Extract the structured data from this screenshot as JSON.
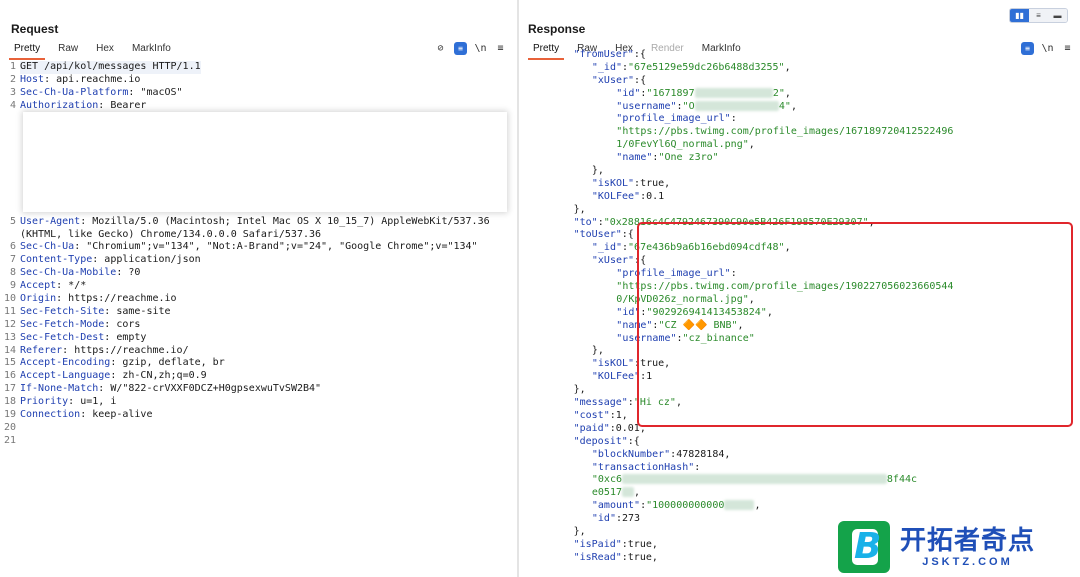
{
  "request": {
    "title": "Request",
    "tabs": [
      "Pretty",
      "Raw",
      "Hex",
      "MarkInfo"
    ],
    "active_tab": "Pretty",
    "tools": {
      "hide": "⊘",
      "newline": "\\n",
      "menu": "≡"
    },
    "lines": [
      {
        "n": "1",
        "k": "",
        "v": "GET /api/kol/messages HTTP/1.1"
      },
      {
        "n": "2",
        "k": "Host",
        "v": "api.reachme.io"
      },
      {
        "n": "3",
        "k": "Sec-Ch-Ua-Platform",
        "v": "\"macOS\""
      },
      {
        "n": "4",
        "k": "Authorization",
        "v": "Bearer"
      },
      {
        "n": "",
        "k": "",
        "v": ""
      },
      {
        "n": "",
        "k": "",
        "v": ""
      },
      {
        "n": "",
        "k": "",
        "v": ""
      },
      {
        "n": "",
        "k": "",
        "v": ""
      },
      {
        "n": "",
        "k": "",
        "v": ""
      },
      {
        "n": "",
        "k": "",
        "v": ""
      },
      {
        "n": "",
        "k": "",
        "v": ""
      },
      {
        "n": "",
        "k": "",
        "v": ""
      },
      {
        "n": "5",
        "k": "User-Agent",
        "v": "Mozilla/5.0 (Macintosh; Intel Mac OS X 10_15_7) AppleWebKit/537.36"
      },
      {
        "n": "",
        "k": "",
        "v": "(KHTML, like Gecko) Chrome/134.0.0.0 Safari/537.36"
      },
      {
        "n": "6",
        "k": "Sec-Ch-Ua",
        "v": "\"Chromium\";v=\"134\", \"Not:A-Brand\";v=\"24\", \"Google Chrome\";v=\"134\""
      },
      {
        "n": "7",
        "k": "Content-Type",
        "v": "application/json"
      },
      {
        "n": "8",
        "k": "Sec-Ch-Ua-Mobile",
        "v": "?0"
      },
      {
        "n": "9",
        "k": "Accept",
        "v": "*/*"
      },
      {
        "n": "10",
        "k": "Origin",
        "v": "https://reachme.io"
      },
      {
        "n": "11",
        "k": "Sec-Fetch-Site",
        "v": "same-site"
      },
      {
        "n": "12",
        "k": "Sec-Fetch-Mode",
        "v": "cors"
      },
      {
        "n": "13",
        "k": "Sec-Fetch-Dest",
        "v": "empty"
      },
      {
        "n": "14",
        "k": "Referer",
        "v": "https://reachme.io/"
      },
      {
        "n": "15",
        "k": "Accept-Encoding",
        "v": "gzip, deflate, br"
      },
      {
        "n": "16",
        "k": "Accept-Language",
        "v": "zh-CN,zh;q=0.9"
      },
      {
        "n": "17",
        "k": "If-None-Match",
        "v": "W/\"822-crVXXF0DCZ+H0gpsexwuTvSW2B4\""
      },
      {
        "n": "18",
        "k": "Priority",
        "v": "u=1, i"
      },
      {
        "n": "19",
        "k": "Connection",
        "v": "keep-alive"
      },
      {
        "n": "20",
        "k": "",
        "v": ""
      },
      {
        "n": "21",
        "k": "",
        "v": ""
      }
    ]
  },
  "response": {
    "title": "Response",
    "tabs": [
      "Pretty",
      "Raw",
      "Hex",
      "Render",
      "MarkInfo"
    ],
    "active_tab": "Pretty",
    "disabled_tabs": [
      "Render"
    ],
    "tools": {
      "newline": "\\n",
      "menu": "≡"
    },
    "layout_toggle": [
      "▮▮",
      "≡",
      "▬"
    ],
    "lines": [
      {
        "i": 6,
        "parts": [
          [
            "k",
            "\"fromUser\""
          ],
          [
            "n",
            ":{"
          ]
        ]
      },
      {
        "i": 9,
        "parts": [
          [
            "k",
            "\"_id\""
          ],
          [
            "n",
            ":"
          ],
          [
            "s",
            "\"67e5129e59dc26b6488d3255\""
          ],
          [
            "n",
            ","
          ]
        ]
      },
      {
        "i": 9,
        "parts": [
          [
            "k",
            "\"xUser\""
          ],
          [
            "n",
            ":{"
          ]
        ]
      },
      {
        "i": 13,
        "parts": [
          [
            "k",
            "\"id\""
          ],
          [
            "n",
            ":"
          ],
          [
            "s",
            "\"1671897"
          ],
          [
            "b",
            "             "
          ],
          [
            "s",
            "2\""
          ],
          [
            "n",
            ","
          ]
        ]
      },
      {
        "i": 13,
        "parts": [
          [
            "k",
            "\"username\""
          ],
          [
            "n",
            ":"
          ],
          [
            "s",
            "\"O"
          ],
          [
            "b",
            "              "
          ],
          [
            "s",
            "4\""
          ],
          [
            "n",
            ","
          ]
        ]
      },
      {
        "i": 13,
        "parts": [
          [
            "k",
            "\"profile_image_url\""
          ],
          [
            "n",
            ":"
          ]
        ]
      },
      {
        "i": 13,
        "parts": [
          [
            "s",
            "\"https://pbs.twimg.com/profile_images/167189720412522496"
          ]
        ]
      },
      {
        "i": 13,
        "parts": [
          [
            "s",
            "1/0FevYl6Q_normal.png\""
          ],
          [
            "n",
            ","
          ]
        ]
      },
      {
        "i": 13,
        "parts": [
          [
            "k",
            "\"name\""
          ],
          [
            "n",
            ":"
          ],
          [
            "s",
            "\"One z3ro\""
          ]
        ]
      },
      {
        "i": 9,
        "parts": [
          [
            "n",
            "},"
          ]
        ]
      },
      {
        "i": 9,
        "parts": [
          [
            "k",
            "\"isKOL\""
          ],
          [
            "n",
            ":true,"
          ]
        ]
      },
      {
        "i": 9,
        "parts": [
          [
            "k",
            "\"KOLFee\""
          ],
          [
            "n",
            ":0.1"
          ]
        ]
      },
      {
        "i": 6,
        "parts": [
          [
            "n",
            "},"
          ]
        ]
      },
      {
        "i": 6,
        "parts": [
          [
            "k",
            "\"to\""
          ],
          [
            "n",
            ":"
          ],
          [
            "s",
            "\"0x28816c4C4792467390C90e5B426F198570E29307\""
          ],
          [
            "n",
            ","
          ]
        ]
      },
      {
        "i": 6,
        "parts": [
          [
            "k",
            "\"toUser\""
          ],
          [
            "n",
            ":{"
          ]
        ]
      },
      {
        "i": 9,
        "parts": [
          [
            "k",
            "\"_id\""
          ],
          [
            "n",
            ":"
          ],
          [
            "s",
            "\"67e436b9a6b16ebd094cdf48\""
          ],
          [
            "n",
            ","
          ]
        ]
      },
      {
        "i": 9,
        "parts": [
          [
            "k",
            "\"xUser\""
          ],
          [
            "n",
            ":{"
          ]
        ]
      },
      {
        "i": 13,
        "parts": [
          [
            "k",
            "\"profile_image_url\""
          ],
          [
            "n",
            ":"
          ]
        ]
      },
      {
        "i": 13,
        "parts": [
          [
            "s",
            "\"https://pbs.twimg.com/profile_images/190227056023660544"
          ]
        ]
      },
      {
        "i": 13,
        "parts": [
          [
            "s",
            "0/KpVD026z_normal.jpg\""
          ],
          [
            "n",
            ","
          ]
        ]
      },
      {
        "i": 13,
        "parts": [
          [
            "k",
            "\"id\""
          ],
          [
            "n",
            ":"
          ],
          [
            "s",
            "\"902926941413453824\""
          ],
          [
            "n",
            ","
          ]
        ]
      },
      {
        "i": 13,
        "parts": [
          [
            "k",
            "\"name\""
          ],
          [
            "n",
            ":"
          ],
          [
            "s",
            "\"CZ 🔶🔶 BNB\""
          ],
          [
            "n",
            ","
          ]
        ]
      },
      {
        "i": 13,
        "parts": [
          [
            "k",
            "\"username\""
          ],
          [
            "n",
            ":"
          ],
          [
            "s",
            "\"cz_binance\""
          ]
        ]
      },
      {
        "i": 9,
        "parts": [
          [
            "n",
            "},"
          ]
        ]
      },
      {
        "i": 9,
        "parts": [
          [
            "k",
            "\"isKOL\""
          ],
          [
            "n",
            ":true,"
          ]
        ]
      },
      {
        "i": 9,
        "parts": [
          [
            "k",
            "\"KOLFee\""
          ],
          [
            "n",
            ":1"
          ]
        ]
      },
      {
        "i": 6,
        "parts": [
          [
            "n",
            "},"
          ]
        ]
      },
      {
        "i": 6,
        "parts": [
          [
            "k",
            "\"message\""
          ],
          [
            "n",
            ":"
          ],
          [
            "s",
            "\"Hi cz\""
          ],
          [
            "n",
            ","
          ]
        ]
      },
      {
        "i": 6,
        "parts": [
          [
            "k",
            "\"cost\""
          ],
          [
            "n",
            ":1,"
          ]
        ]
      },
      {
        "i": 6,
        "parts": [
          [
            "k",
            "\"paid\""
          ],
          [
            "n",
            ":0.01,"
          ]
        ]
      },
      {
        "i": 6,
        "parts": [
          [
            "k",
            "\"deposit\""
          ],
          [
            "n",
            ":{"
          ]
        ]
      },
      {
        "i": 9,
        "parts": [
          [
            "k",
            "\"blockNumber\""
          ],
          [
            "n",
            ":47828184,"
          ]
        ]
      },
      {
        "i": 9,
        "parts": [
          [
            "k",
            "\"transactionHash\""
          ],
          [
            "n",
            ":"
          ]
        ]
      },
      {
        "i": 9,
        "parts": [
          [
            "s",
            "\"0xc6"
          ],
          [
            "b",
            "                                            "
          ],
          [
            "s",
            "8f44c"
          ]
        ]
      },
      {
        "i": 9,
        "parts": [
          [
            "s",
            "e0517"
          ],
          [
            "b",
            "  "
          ],
          [
            "n",
            ","
          ]
        ]
      },
      {
        "i": 9,
        "parts": [
          [
            "k",
            "\"amount\""
          ],
          [
            "n",
            ":"
          ],
          [
            "s",
            "\"100000000000"
          ],
          [
            "b",
            "     "
          ],
          [
            "n",
            ","
          ]
        ]
      },
      {
        "i": 9,
        "parts": [
          [
            "k",
            "\"id\""
          ],
          [
            "n",
            ":273"
          ]
        ]
      },
      {
        "i": 6,
        "parts": [
          [
            "n",
            "},"
          ]
        ]
      },
      {
        "i": 6,
        "parts": [
          [
            "k",
            "\"isPaid\""
          ],
          [
            "n",
            ":true,"
          ]
        ]
      },
      {
        "i": 6,
        "parts": [
          [
            "k",
            "\"isRead\""
          ],
          [
            "n",
            ":true,"
          ]
        ]
      }
    ]
  },
  "watermark": {
    "logo_letter": "B",
    "title": "开拓者奇点",
    "subtitle": "JSKTZ.COM"
  },
  "colors": {
    "accent_tab": "#e8623a",
    "key": "#1f3fb0",
    "string": "#2a8a2a",
    "highlight_border": "#e0262c",
    "brand_blue": "#2f6fd6"
  }
}
